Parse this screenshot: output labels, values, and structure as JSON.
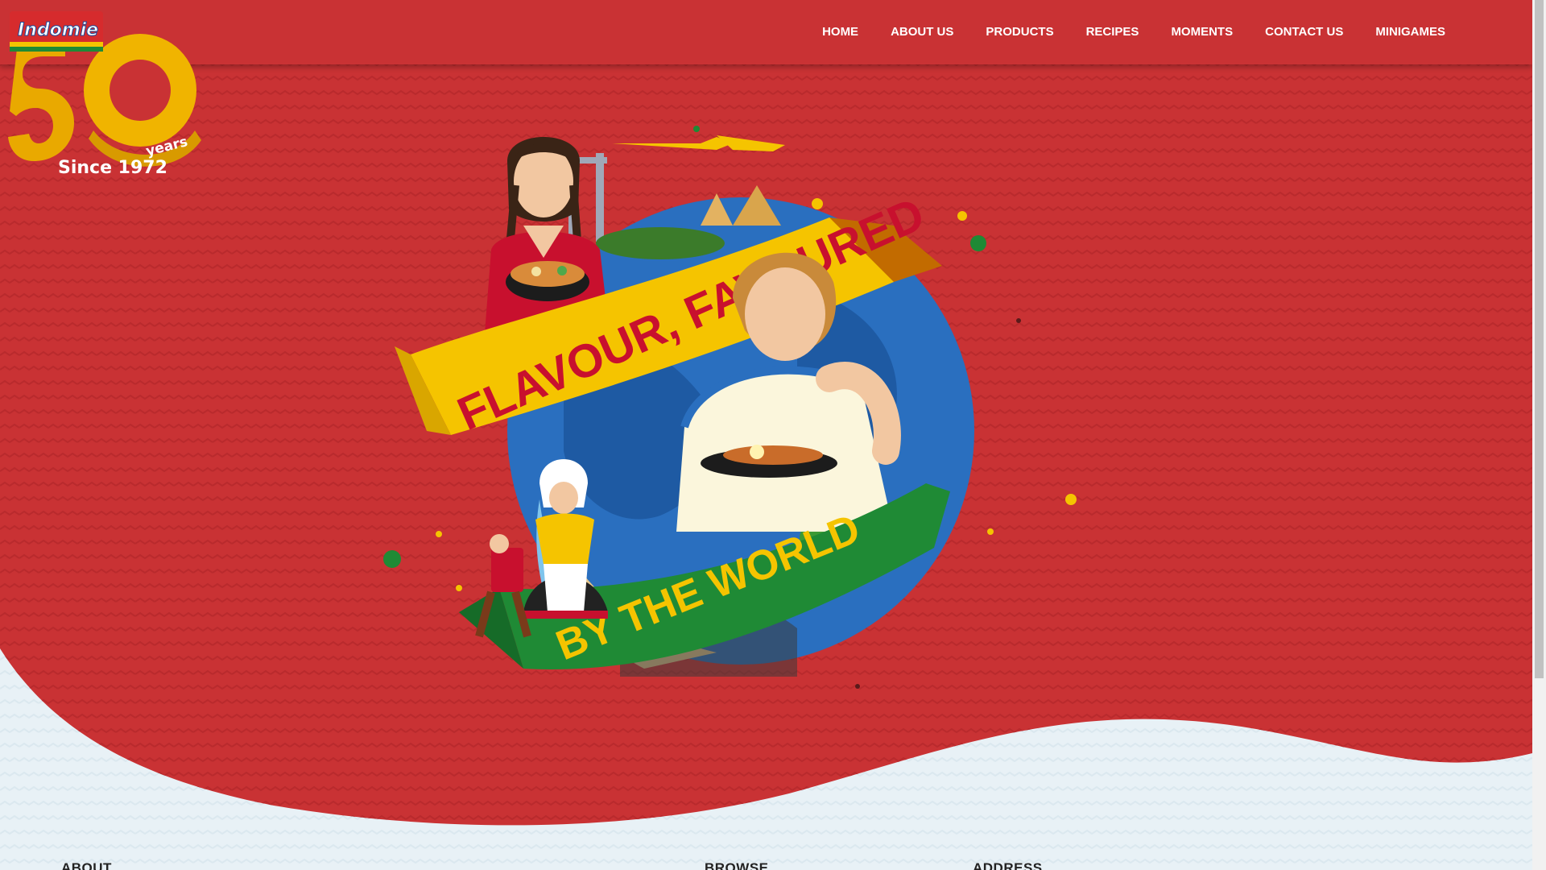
{
  "brand": {
    "logo_text": "Indomie",
    "anniversary_number": "50",
    "anniversary_word": "years",
    "since": "Since 1972"
  },
  "nav": {
    "items": [
      {
        "label": "HOME"
      },
      {
        "label": "ABOUT US"
      },
      {
        "label": "PRODUCTS"
      },
      {
        "label": "RECIPES"
      },
      {
        "label": "MOMENTS"
      },
      {
        "label": "CONTACT US"
      },
      {
        "label": "MINIGAMES"
      }
    ]
  },
  "hero": {
    "banner_top": "FLAVOUR, FAVOURED",
    "banner_bottom": "BY THE WORLD"
  },
  "footer": {
    "about_heading": "ABOUT",
    "browse_heading": "BROWSE",
    "address_heading": "ADDRESS"
  },
  "colors": {
    "hero_red": "#c93234",
    "banner_yellow": "#f5c400",
    "banner_green": "#1f8a35",
    "globe_blue": "#2a6fbf",
    "footer_bg": "#e8f1f6",
    "gold": "#e9a900"
  }
}
